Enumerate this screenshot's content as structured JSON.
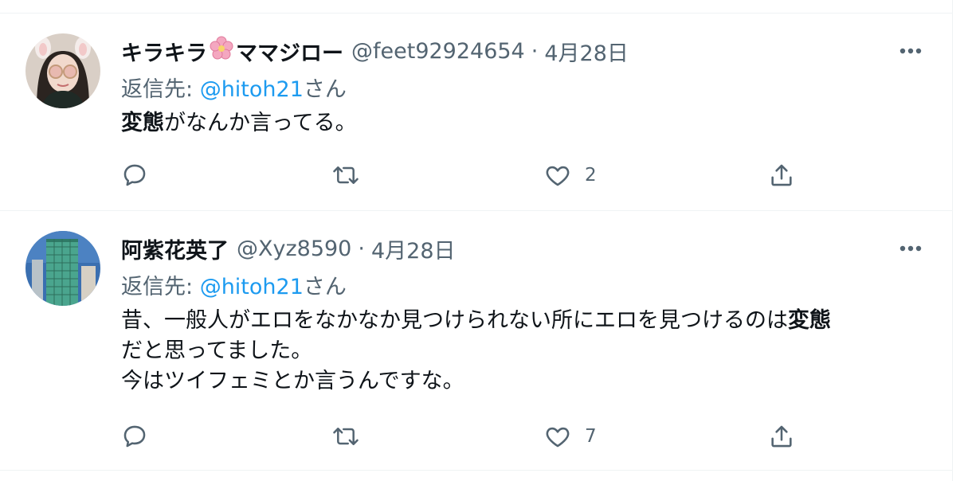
{
  "tweets": [
    {
      "name_part1": "キラキラ",
      "name_emoji": "cherry-blossom",
      "name_part2": "ママジロー",
      "handle": "@feet92924654",
      "separator": "·",
      "date": "4月28日",
      "reply_prefix": "返信先: ",
      "reply_handle": "@hitoh21",
      "reply_suffix": "さん",
      "text_bold": "変態",
      "text_rest": "がなんか言ってる。",
      "likes": "2"
    },
    {
      "name": "阿紫花英了",
      "handle": "@Xyz8590",
      "separator": "·",
      "date": "4月28日",
      "reply_prefix": "返信先: ",
      "reply_handle": "@hitoh21",
      "reply_suffix": "さん",
      "line1_text": "昔、一般人がエロをなかなか見つけられない所にエロを見つけるのは",
      "line1_bold": "変態",
      "line2": "だと思ってました。",
      "line3": "今はツイフェミとか言うんですな。",
      "likes": "7"
    }
  ],
  "icons": {
    "more": "more-horizontal-icon",
    "reply": "reply-icon",
    "retweet": "retweet-icon",
    "like": "heart-icon",
    "share": "share-icon"
  },
  "colors": {
    "link": "#1d9bf0",
    "secondary_text": "#536471",
    "divider": "#eff3f4"
  }
}
